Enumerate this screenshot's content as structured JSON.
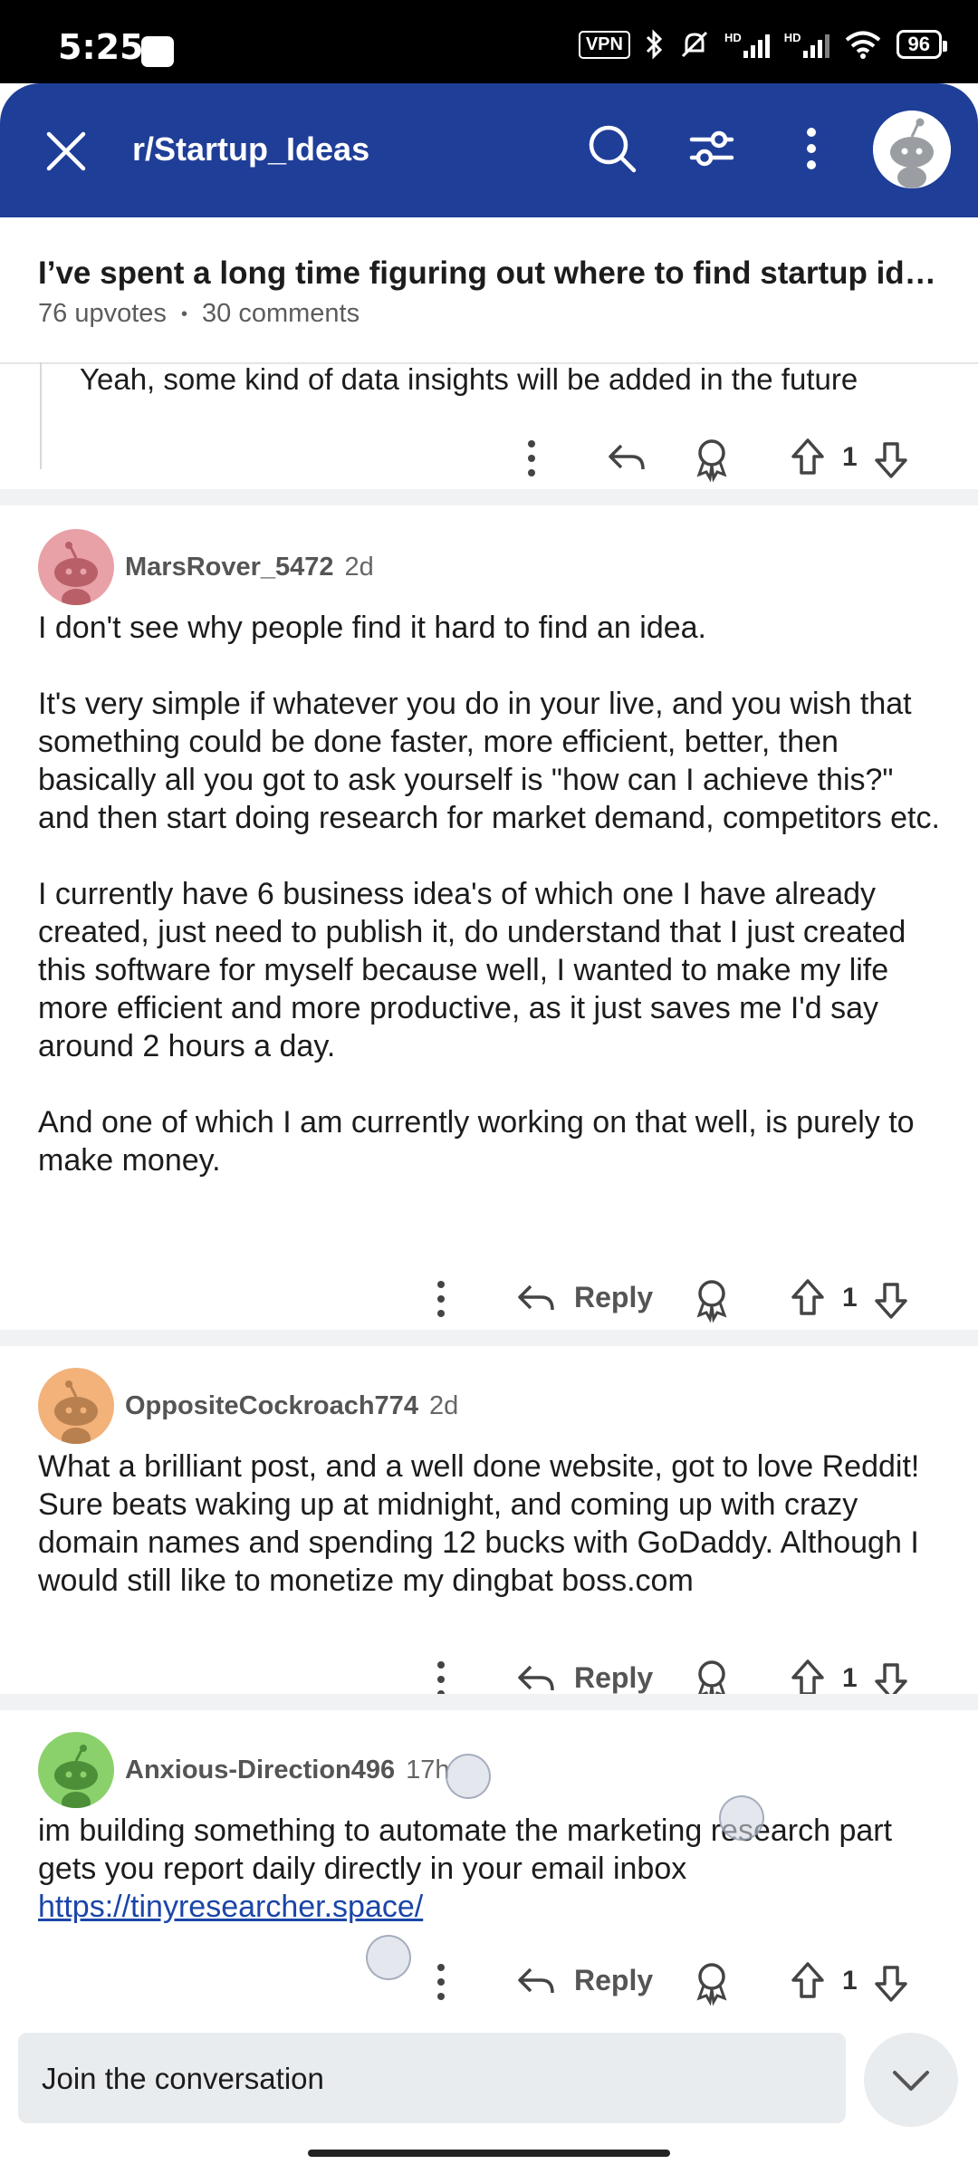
{
  "status_bar": {
    "time": "5:25",
    "vpn": "VPN",
    "battery": "96",
    "hd1": "HD",
    "hd2": "HD"
  },
  "app_bar": {
    "subreddit": "r/Startup_Ideas",
    "icons": [
      "close-icon",
      "search-icon",
      "filter-icon",
      "more-icon",
      "avatar"
    ]
  },
  "post": {
    "title": "I’ve spent a long time figuring out where to find startup idea…",
    "upvotes": "76 upvotes",
    "dot": "•",
    "comments": "30 comments"
  },
  "previous_reply": {
    "text": "Yeah, some kind of data insights will be added in the future",
    "votes": "1"
  },
  "comments": [
    {
      "username": "MarsRover_5472",
      "age": "2d",
      "avatar_color": "#e8a1a7",
      "paragraphs": [
        "I don't see why people find it hard to find an idea.",
        "It's very simple if whatever you do in your live, and you wish that something could be done faster, more efficient, better, then basically all you got to ask yourself is \"how can I achieve this?\" and then start doing research for market demand, competitors etc.",
        "I currently have 6 business idea's of which one I have already created, just need to publish it, do understand that I just created this software for myself because well, I wanted to make my life more efficient and more productive, as it just saves me I'd say around 2 hours a day.",
        "And one of which I am currently working on that well, is purely to make money."
      ],
      "reply_label": "Reply",
      "votes": "1"
    },
    {
      "username": "OppositeCockroach774",
      "age": "2d",
      "avatar_color": "#f2b27a",
      "paragraphs": [
        "What a brilliant post, and a well done website, got to love Reddit! Sure beats waking up at midnight, and coming up with crazy domain names and spending 12 bucks with GoDaddy. Although I would still like to monetize my dingbat boss.com"
      ],
      "reply_label": "Reply",
      "votes": "1"
    },
    {
      "username": "Anxious-Direction496",
      "age": "17h",
      "avatar_color": "#8ad16b",
      "paragraphs": [
        "im building something to automate the marketing research part gets you report daily directly in your email inbox"
      ],
      "link": "https://tinyresearcher.space/",
      "reply_label": "Reply",
      "votes": "1"
    }
  ],
  "composer": {
    "placeholder": "Join the conversation"
  },
  "colors": {
    "app_bar": "#1f3e98",
    "composer_bg": "#e9ecef",
    "link": "#1b46a8"
  }
}
